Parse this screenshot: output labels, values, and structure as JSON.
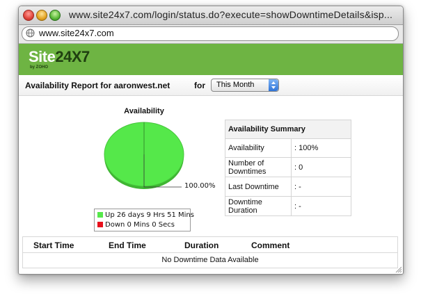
{
  "window": {
    "title": "www.site24x7.com/login/status.do?execute=showDowntimeDetails&isp...",
    "address": "www.site24x7.com"
  },
  "brand": {
    "logo_prefix": "Site",
    "logo_number": "24X7",
    "logo_byline": "by ZOHO",
    "accent_color": "#6eb443"
  },
  "report": {
    "title": "Availability Report for aaronwest.net",
    "for_label": "for",
    "period_selected": "This Month"
  },
  "chart": {
    "title": "Availability",
    "slice_label": "100.00%",
    "legend": [
      {
        "label": "Up 26 days 9 Hrs 51 Mins",
        "color": "#55e84a"
      },
      {
        "label": "Down 0 Mins 0 Secs",
        "color": "#e8101c"
      }
    ]
  },
  "chart_data": {
    "type": "pie",
    "title": "Availability",
    "categories": [
      "Up 26 days 9 Hrs 51 Mins",
      "Down 0 Mins 0 Secs"
    ],
    "values": [
      100.0,
      0.0
    ],
    "colors": [
      "#55e84a",
      "#e8101c"
    ],
    "data_labels": [
      "100.00%"
    ],
    "legend_position": "bottom"
  },
  "summary": {
    "header": "Availability Summary",
    "rows": [
      {
        "label": "Availability",
        "value": ": 100%"
      },
      {
        "label": "Number of Downtimes",
        "value": ": 0"
      },
      {
        "label": "Last Downtime",
        "value": ": -"
      },
      {
        "label": "Downtime Duration",
        "value": ": -"
      }
    ]
  },
  "downtime_table": {
    "columns": [
      "Start Time",
      "End Time",
      "Duration",
      "Comment"
    ],
    "empty_text": "No Downtime Data Available"
  }
}
